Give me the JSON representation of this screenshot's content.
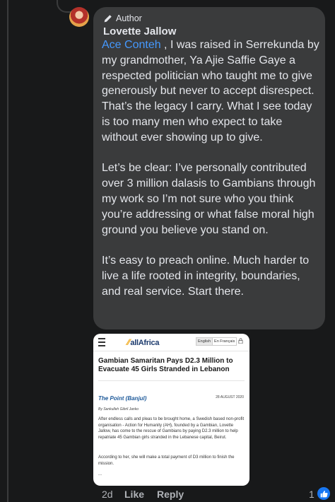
{
  "comment": {
    "badge_label": "Author",
    "author_name": "Lovette Jallow",
    "mention": "Ace Conteh",
    "first_paragraph_rest": " , I was raised in Serrekunda by my grandmother, Ya Ajie Saffie Gaye a respected politician who taught me to give generously but never to accept disrespect. That’s the legacy I carry. What I see today is too many men who expect to take without ever showing up to give.",
    "second_paragraph": "Let’s be clear: I’ve personally contributed over 3 million dalasis to Gambians through my work so I’m not sure who you think you’re addressing or what false moral high ground you believe you stand on.",
    "third_paragraph": "It’s easy to preach online. Much harder to live a life rooted in integrity, boundaries, and real service. Start there."
  },
  "attachment": {
    "site_logo": "allAfrica",
    "lang_english": "English",
    "lang_french": "En Français",
    "headline": "Gambian Samaritan Pays D2.3 Million to Evacuate 45 Girls Stranded in Lebanon",
    "source": "The Point (Banjul)",
    "date": "28 AUGUST 2020",
    "byline": "By Sankulleh Gibril Janko",
    "paragraph1": "After endless calls and pleas to be brought home, a Swedish based non-profit organisation - Action for Humanity (AH), founded by a Gambian, Lovette Jallow, has come to the rescue of Gambians by paying D2.3 million to help repatriate 45 Gambian girls stranded in the Lebanese capital, Beirut.",
    "paragraph2": "According to her, she will make a total payment of D3 million to finish the mission.",
    "ellipsis": "..."
  },
  "actions": {
    "timestamp": "2d",
    "like_label": "Like",
    "reply_label": "Reply",
    "reaction_count": "1"
  },
  "colors": {
    "background": "#18191a",
    "bubble": "#3a3b3c",
    "mention": "#4599ff",
    "like_reaction": "#1877f2"
  },
  "icons": [
    "pencil-icon",
    "hamburger-menu-icon",
    "lock-icon",
    "thumbs-up-icon"
  ]
}
